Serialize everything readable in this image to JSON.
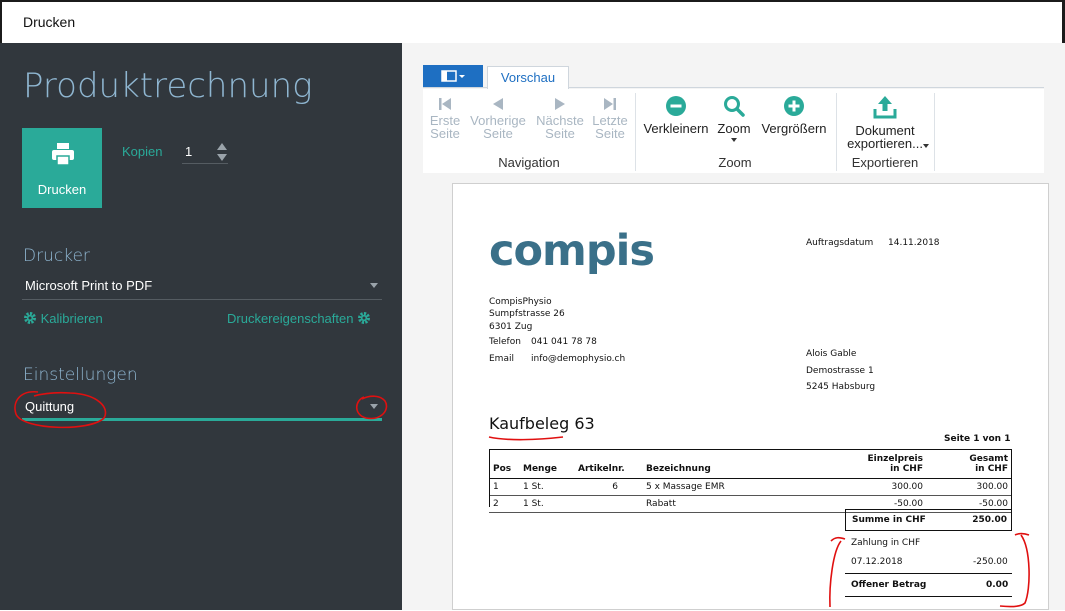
{
  "window": {
    "title": "Drucken"
  },
  "left": {
    "heading": "Produktrechnung",
    "print_button_label": "Drucken",
    "copies_label": "Kopien",
    "copies_value": "1",
    "printer_section": "Drucker",
    "printer_value": "Microsoft Print to PDF",
    "calibrate_label": "Kalibrieren",
    "printer_props_label": "Druckereigenschaften",
    "settings_section": "Einstellungen",
    "settings_value": "Quittung"
  },
  "ribbon": {
    "tab_preview": "Vorschau",
    "nav": {
      "first": [
        "Erste",
        "Seite"
      ],
      "prev": [
        "Vorherige",
        "Seite"
      ],
      "next": [
        "Nächste",
        "Seite"
      ],
      "last": [
        "Letzte",
        "Seite"
      ],
      "group": "Navigation"
    },
    "zoom": {
      "out": "Verkleinern",
      "zoom": "Zoom",
      "in": "Vergrößern",
      "group": "Zoom"
    },
    "export": {
      "doc": [
        "Dokument",
        "exportieren..."
      ],
      "group": "Exportieren"
    },
    "colors": {
      "accent": "#2aaa99",
      "disabled": "#a9b6c2",
      "tab": "#1e6fc2"
    }
  },
  "document": {
    "logo": "compis",
    "order_date_label": "Auftragsdatum",
    "order_date": "14.11.2018",
    "sender": [
      "CompisPhysio",
      "Sumpfstrasse 26",
      "6301 Zug"
    ],
    "phone_label": "Telefon",
    "phone": "041 041 78 78",
    "email_label": "Email",
    "email": "info@demophysio.ch",
    "recipient": [
      "Alois Gable",
      "Demostrasse 1",
      "5245 Habsburg"
    ],
    "title": "Kaufbeleg",
    "number": "63",
    "page_info": "Seite 1 von 1",
    "columns": [
      "Pos",
      "Menge",
      "Artikelnr.",
      "Bezeichnung",
      "Einzelpreis in CHF",
      "Gesamt in CHF"
    ],
    "rows": [
      [
        "1",
        "1 St.",
        "6",
        "5 x Massage EMR",
        "300.00",
        "300.00"
      ],
      [
        "2",
        "1 St.",
        "",
        "Rabatt",
        "-50.00",
        "-50.00"
      ]
    ],
    "sum_label": "Summe in CHF",
    "sum_value": "250.00",
    "payment_label": "Zahlung in CHF",
    "payment_date": "07.12.2018",
    "payment_value": "-250.00",
    "open_label": "Offener Betrag",
    "open_value": "0.00"
  }
}
